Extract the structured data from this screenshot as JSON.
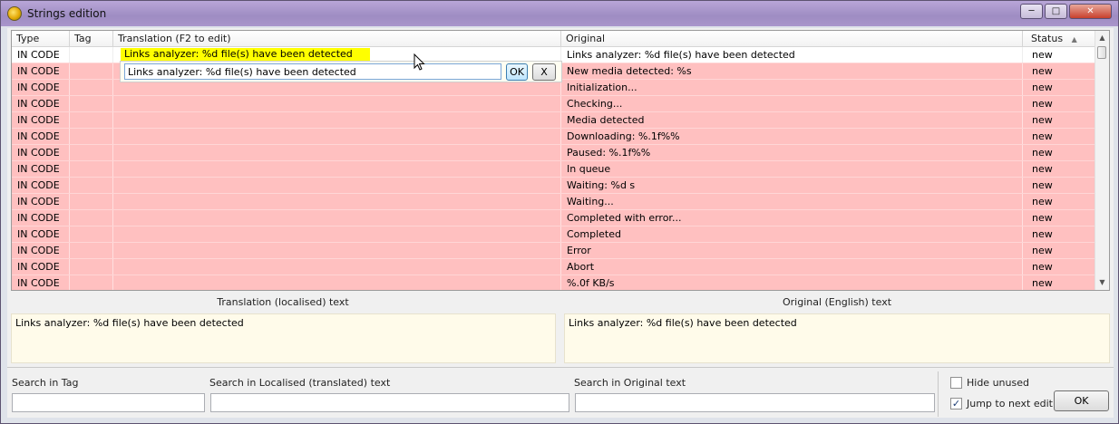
{
  "window": {
    "title": "Strings edition",
    "controls": [
      "─",
      "□",
      "✕"
    ]
  },
  "table": {
    "columns": [
      "Type",
      "Tag",
      "Translation (F2 to edit)",
      "Original",
      "Status"
    ],
    "sort_indicator": "▲",
    "rows": [
      {
        "type": "IN CODE",
        "tag": "",
        "translation": "",
        "original": "Links analyzer: %d file(s) have been detected",
        "status": "new"
      },
      {
        "type": "IN CODE",
        "tag": "",
        "translation": "",
        "original": "New media detected: %s",
        "status": "new"
      },
      {
        "type": "IN CODE",
        "tag": "",
        "translation": "",
        "original": "Initialization...",
        "status": "new"
      },
      {
        "type": "IN CODE",
        "tag": "",
        "translation": "",
        "original": "Checking...",
        "status": "new"
      },
      {
        "type": "IN CODE",
        "tag": "",
        "translation": "",
        "original": "Media detected",
        "status": "new"
      },
      {
        "type": "IN CODE",
        "tag": "",
        "translation": "",
        "original": "Downloading: %.1f%%",
        "status": "new"
      },
      {
        "type": "IN CODE",
        "tag": "",
        "translation": "",
        "original": "Paused: %.1f%%",
        "status": "new"
      },
      {
        "type": "IN CODE",
        "tag": "",
        "translation": "",
        "original": "In queue",
        "status": "new"
      },
      {
        "type": "IN CODE",
        "tag": "",
        "translation": "",
        "original": "Waiting: %d s",
        "status": "new"
      },
      {
        "type": "IN CODE",
        "tag": "",
        "translation": "",
        "original": "Waiting...",
        "status": "new"
      },
      {
        "type": "IN CODE",
        "tag": "",
        "translation": "",
        "original": "Completed with error...",
        "status": "new"
      },
      {
        "type": "IN CODE",
        "tag": "",
        "translation": "",
        "original": "Completed",
        "status": "new"
      },
      {
        "type": "IN CODE",
        "tag": "",
        "translation": "",
        "original": "Error",
        "status": "new"
      },
      {
        "type": "IN CODE",
        "tag": "",
        "translation": "",
        "original": "Abort",
        "status": "new"
      },
      {
        "type": "IN CODE",
        "tag": "",
        "translation": "",
        "original": "%.0f KB/s",
        "status": "new"
      }
    ],
    "highlight_text": "Links analyzer: %d file(s) have been detected",
    "editor": {
      "value": "Links analyzer: %d file(s) have been detected",
      "ok_label": "OK",
      "cancel_label": "X"
    }
  },
  "panels": {
    "translation_label": "Translation (localised) text",
    "translation_text": "Links analyzer: %d file(s) have been detected",
    "original_label": "Original (English) text",
    "original_text": "Links analyzer: %d file(s) have been detected"
  },
  "search": {
    "tag_label": "Search in Tag",
    "localised_label": "Search in Localised (translated) text",
    "original_label": "Search in Original text",
    "tag_value": "",
    "localised_value": "",
    "original_value": ""
  },
  "options": {
    "hide_unused_label": "Hide unused",
    "hide_unused": false,
    "jump_next_label": "Jump to next edit",
    "jump_next": true,
    "check_mark": "✓",
    "ok_label": "OK"
  },
  "colors": {
    "row_new": "#ffc0c0",
    "highlight": "#ffff00",
    "text_panel": "#fffbea"
  }
}
